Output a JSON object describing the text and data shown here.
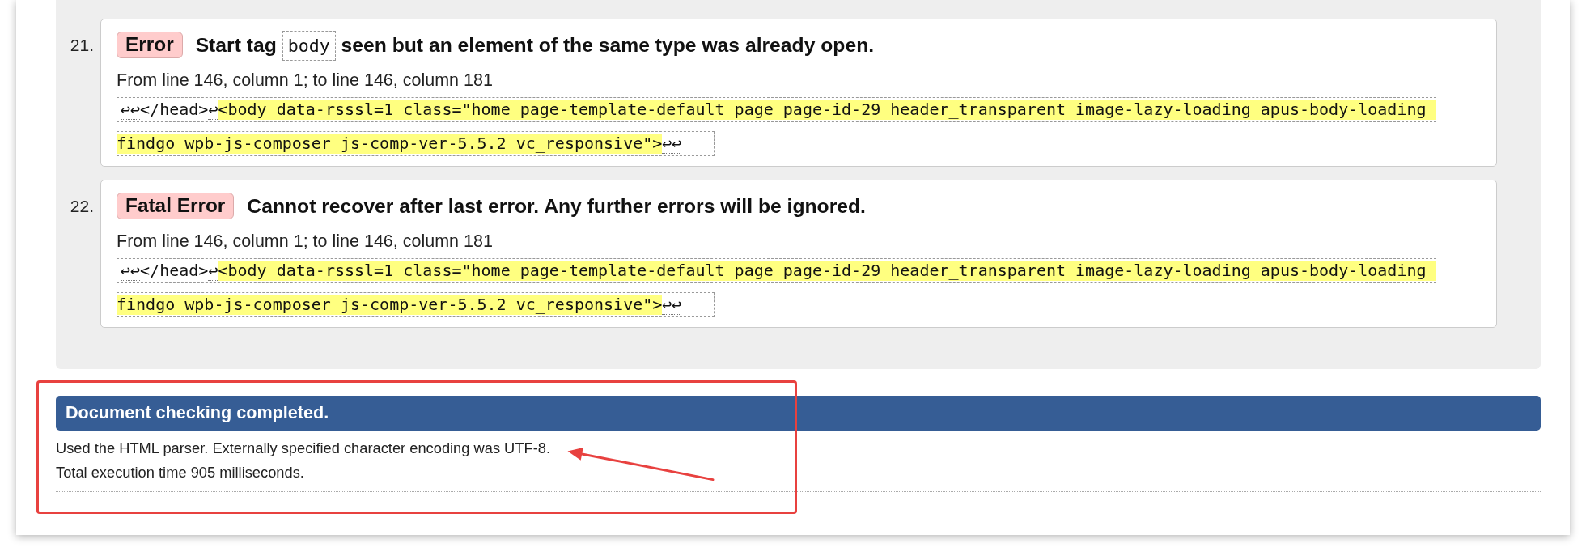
{
  "messages": [
    {
      "number": "21.",
      "severity": "Error",
      "message": [
        {
          "kind": "text",
          "text": "Start tag"
        },
        {
          "kind": "code",
          "text": "body"
        },
        {
          "kind": "text",
          "text": "seen but an element of the same type was already open."
        }
      ],
      "location": "From line 146, column 1; to line 146, column 181",
      "extract_lines": [
        [
          {
            "kind": "linebreak",
            "text": "↩↩"
          },
          {
            "kind": "plain",
            "text": "</head>"
          },
          {
            "kind": "linebreak",
            "text": "↩"
          },
          {
            "kind": "highlight",
            "text": "<body data-rsssl=1 class=\"home page-template-default page page-id-29 header_transparent image-lazy-loading apus-body-loading"
          }
        ],
        [
          {
            "kind": "highlight",
            "text": "findgo wpb-js-composer js-comp-ver-5.5.2 vc_responsive\">"
          },
          {
            "kind": "linebreak",
            "text": "↩↩"
          }
        ]
      ]
    },
    {
      "number": "22.",
      "severity": "Fatal Error",
      "message": [
        {
          "kind": "text",
          "text": "Cannot recover after last error. Any further errors will be ignored."
        }
      ],
      "location": "From line 146, column 1; to line 146, column 181",
      "extract_lines": [
        [
          {
            "kind": "linebreak",
            "text": "↩↩"
          },
          {
            "kind": "plain",
            "text": "</head>"
          },
          {
            "kind": "linebreak",
            "text": "↩"
          },
          {
            "kind": "highlight",
            "text": "<body data-rsssl=1 class=\"home page-template-default page page-id-29 header_transparent image-lazy-loading apus-body-loading"
          }
        ],
        [
          {
            "kind": "highlight",
            "text": "findgo wpb-js-composer js-comp-ver-5.5.2 vc_responsive\">"
          },
          {
            "kind": "linebreak",
            "text": "↩↩"
          }
        ]
      ]
    }
  ],
  "summary": {
    "title": "Document checking completed.",
    "lines": [
      "Used the HTML parser. Externally specified character encoding was UTF-8.",
      "Total execution time 905 milliseconds."
    ]
  }
}
